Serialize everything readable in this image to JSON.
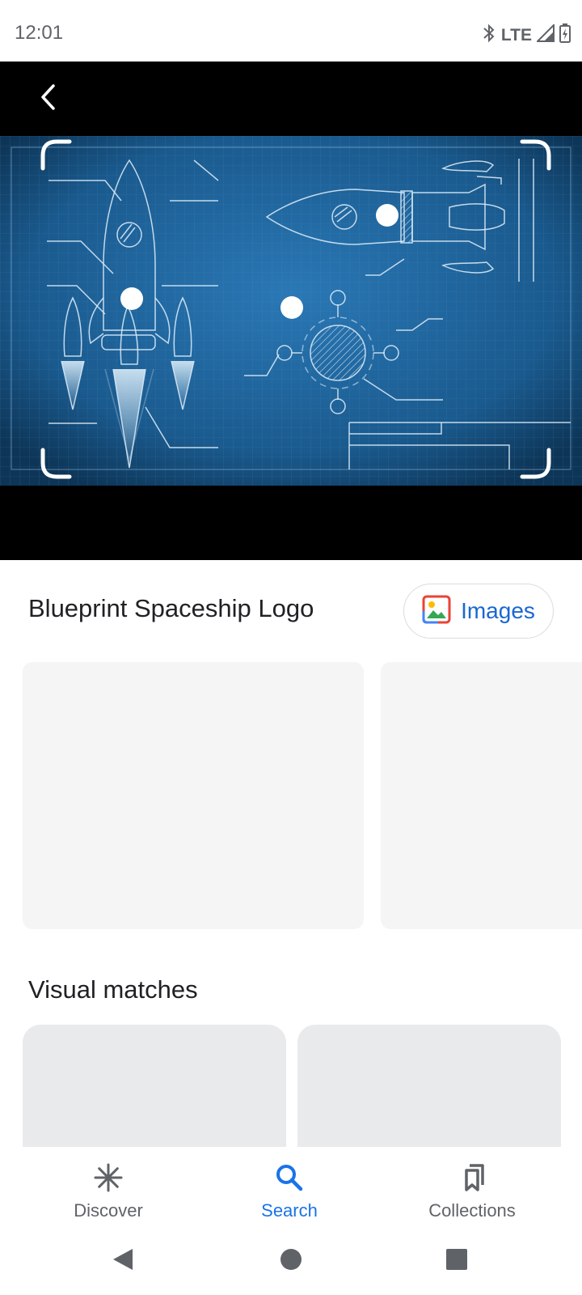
{
  "status_bar": {
    "time": "12:01",
    "network": "LTE",
    "icons": [
      "bluetooth-icon",
      "signal-icon",
      "battery-icon"
    ]
  },
  "viewer": {
    "back_icon": "chevron-left-icon",
    "hotspot_count": 3
  },
  "result": {
    "title": "Blueprint Spaceship Logo",
    "images_button_label": "Images"
  },
  "visual_matches": {
    "title": "Visual matches"
  },
  "bottom_nav": {
    "items": [
      {
        "label": "Discover",
        "icon": "asterisk-icon",
        "active": false
      },
      {
        "label": "Search",
        "icon": "search-icon",
        "active": true
      },
      {
        "label": "Collections",
        "icon": "bookmarks-icon",
        "active": false
      }
    ]
  },
  "colors": {
    "accent": "#1a73e8",
    "blueprint": "#1a5a8e",
    "text": "#202124",
    "muted": "#5f6368"
  }
}
